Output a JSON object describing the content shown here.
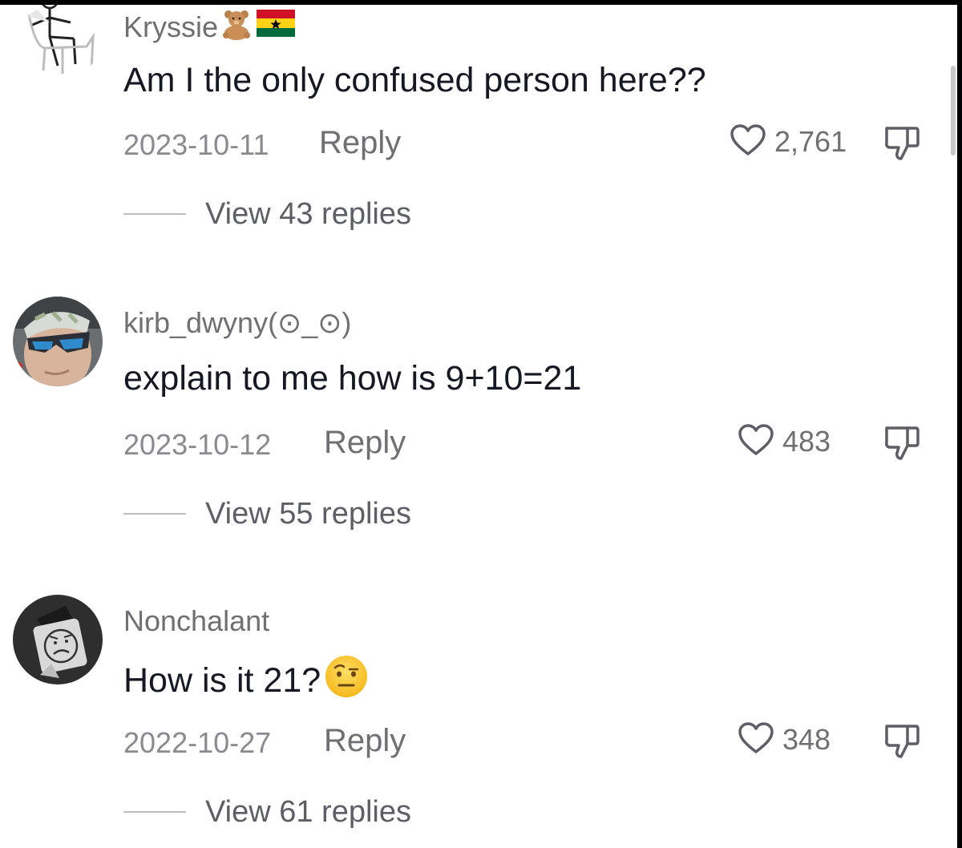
{
  "comments": [
    {
      "username": "Kryssie",
      "username_emojis": [
        "teddy-bear-icon",
        "ghana-flag-icon"
      ],
      "text": "Am I the only confused person here??",
      "date": "2023-10-11",
      "reply_label": "Reply",
      "likes": "2,761",
      "view_replies": "View 43 replies"
    },
    {
      "username": "kirb_dwyny(⊙_⊙)",
      "text": "explain to me how is 9+10=21",
      "date": "2023-10-12",
      "reply_label": "Reply",
      "likes": "483",
      "view_replies": "View 55 replies"
    },
    {
      "username": "Nonchalant",
      "text": "How is it 21?",
      "text_emoji": "raised-eyebrow-face-icon",
      "date": "2022-10-27",
      "reply_label": "Reply",
      "likes": "348",
      "view_replies": "View 61 replies"
    }
  ],
  "colors": {
    "username": "#6f6f74",
    "text": "#161823",
    "meta": "#8a8b91",
    "background": "#ffffff"
  }
}
